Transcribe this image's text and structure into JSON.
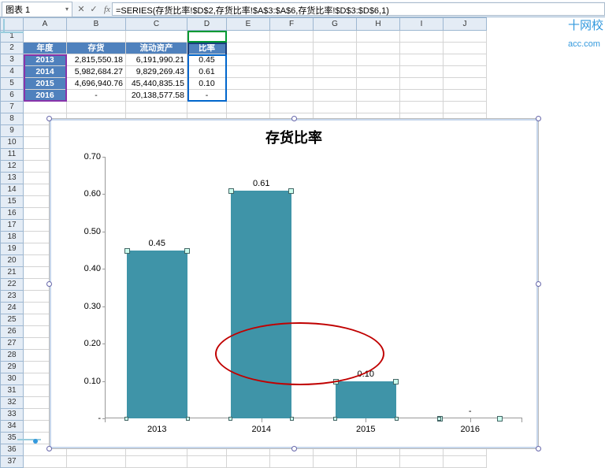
{
  "watermark": {
    "cn": "十网校",
    "en": "acc.com"
  },
  "formula_bar": {
    "name_box": "图表 1",
    "fx_label": "fx",
    "formula": "=SERIES(存货比率!$D$2,存货比率!$A$3:$A$6,存货比率!$D$3:$D$6,1)"
  },
  "columns": [
    "A",
    "B",
    "C",
    "D",
    "E",
    "F",
    "G",
    "H",
    "I",
    "J"
  ],
  "rows": [
    "1",
    "2",
    "3",
    "4",
    "5",
    "6",
    "7",
    "8",
    "9",
    "10",
    "11",
    "12",
    "13",
    "14",
    "15",
    "16",
    "17",
    "18",
    "19",
    "20",
    "21",
    "22",
    "23",
    "24",
    "25",
    "26",
    "27",
    "28",
    "29",
    "30",
    "31",
    "32",
    "33",
    "34",
    "35",
    "36",
    "37"
  ],
  "table": {
    "headers": {
      "A": "年度",
      "B": "存货",
      "C": "流动资产",
      "D": "比率"
    },
    "rows": [
      {
        "year": "2013",
        "inv": "2,815,550.18",
        "cur": "6,191,990.21",
        "rate": "0.45"
      },
      {
        "year": "2014",
        "inv": "5,982,684.27",
        "cur": "9,829,269.43",
        "rate": "0.61"
      },
      {
        "year": "2015",
        "inv": "4,696,940.76",
        "cur": "45,440,835.15",
        "rate": "0.10"
      },
      {
        "year": "2016",
        "inv": "-",
        "cur": "20,138,577.58",
        "rate": "-"
      }
    ]
  },
  "chart_data": {
    "type": "bar",
    "title": "存货比率",
    "categories": [
      "2013",
      "2014",
      "2015",
      "2016"
    ],
    "values": [
      0.45,
      0.61,
      0.1,
      null
    ],
    "value_labels": [
      "0.45",
      "0.61",
      "0.10",
      "-"
    ],
    "xlabel": "",
    "ylabel": "",
    "ylim": [
      0,
      0.7
    ],
    "yticks": [
      "-",
      "0.10",
      "0.20",
      "0.30",
      "0.40",
      "0.50",
      "0.60",
      "0.70"
    ],
    "annotation": {
      "type": "ellipse",
      "approx_center": [
        2013.8,
        0.2
      ]
    }
  }
}
